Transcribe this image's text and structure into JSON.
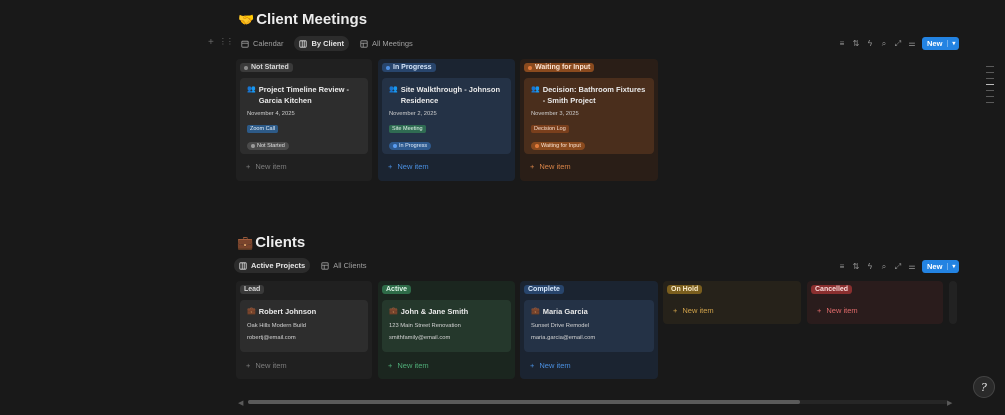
{
  "meetings": {
    "emoji": "🤝",
    "title": "Client Meetings",
    "tabs": [
      "Calendar",
      "By Client",
      "All Meetings"
    ],
    "new_label": "New",
    "columns": [
      {
        "label": "Not Started",
        "card": {
          "title": "Project Timeline Review - Garcia Kitchen",
          "date": "November 4, 2025",
          "tag": "Zoom Call",
          "status": "Not Started"
        }
      },
      {
        "label": "In Progress",
        "card": {
          "title": "Site Walkthrough - Johnson Residence",
          "date": "November 2, 2025",
          "tag": "Site Meeting",
          "status": "In Progress"
        }
      },
      {
        "label": "Waiting for Input",
        "card": {
          "title": "Decision: Bathroom Fixtures - Smith Project",
          "date": "November 3, 2025",
          "tag": "Decision Log",
          "status": "Waiting for Input"
        }
      }
    ],
    "new_item": "New item"
  },
  "clients": {
    "emoji": "💼",
    "title": "Clients",
    "tabs": [
      "Active Projects",
      "All Clients"
    ],
    "new_label": "New",
    "columns": [
      {
        "label": "Lead",
        "card": {
          "name": "Robert Johnson",
          "project": "Oak Hills Modern Build",
          "email": "robertj@email.com"
        }
      },
      {
        "label": "Active",
        "card": {
          "name": "John & Jane Smith",
          "project": "123 Main Street Renovation",
          "email": "smithfamily@email.com"
        }
      },
      {
        "label": "Complete",
        "card": {
          "name": "Maria Garcia",
          "project": "Sunset Drive Remodel",
          "email": "maria.garcia@email.com"
        }
      },
      {
        "label": "On Hold"
      },
      {
        "label": "Cancelled"
      }
    ],
    "new_item": "New item"
  },
  "help_icon": "?"
}
